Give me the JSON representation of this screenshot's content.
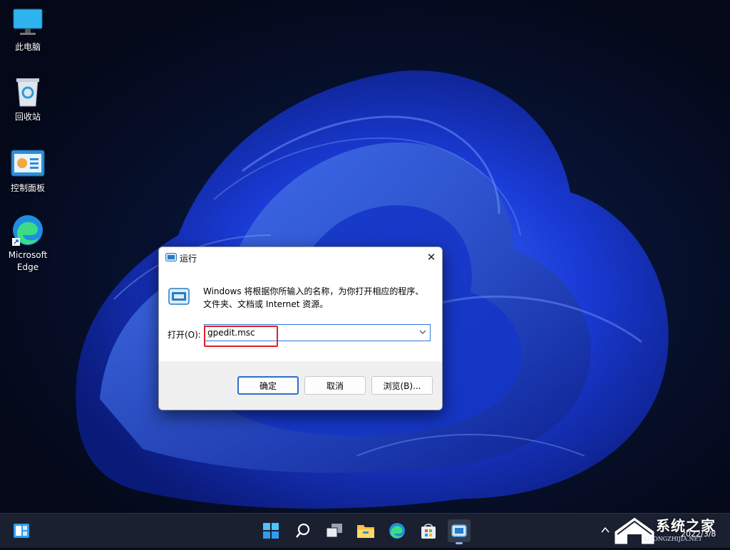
{
  "desktop": {
    "icons": [
      {
        "label": "此电脑"
      },
      {
        "label": "回收站"
      },
      {
        "label": "控制面板"
      },
      {
        "label": "Microsoft Edge"
      }
    ]
  },
  "run_dialog": {
    "title": "运行",
    "close_glyph": "✕",
    "description": "Windows 将根据你所输入的名称，为你打开相应的程序、文件夹、文档或 Internet 资源。",
    "open_label": "打开(O):",
    "open_value": "gpedit.msc",
    "buttons": {
      "ok": "确定",
      "cancel": "取消",
      "browse": "浏览(B)..."
    }
  },
  "taskbar": {
    "icons": [
      "widgets-icon",
      "start-icon",
      "search-icon",
      "task-view-icon",
      "file-explorer-icon",
      "edge-icon",
      "store-icon",
      "run-icon"
    ],
    "date": "2022/3/8"
  },
  "watermark": {
    "text": "系统之家",
    "sub": "XITONGZHIJIA.NET"
  },
  "colors": {
    "accent": "#2f6fc8",
    "highlight": "#e32020",
    "taskbar": "#1b2030"
  }
}
